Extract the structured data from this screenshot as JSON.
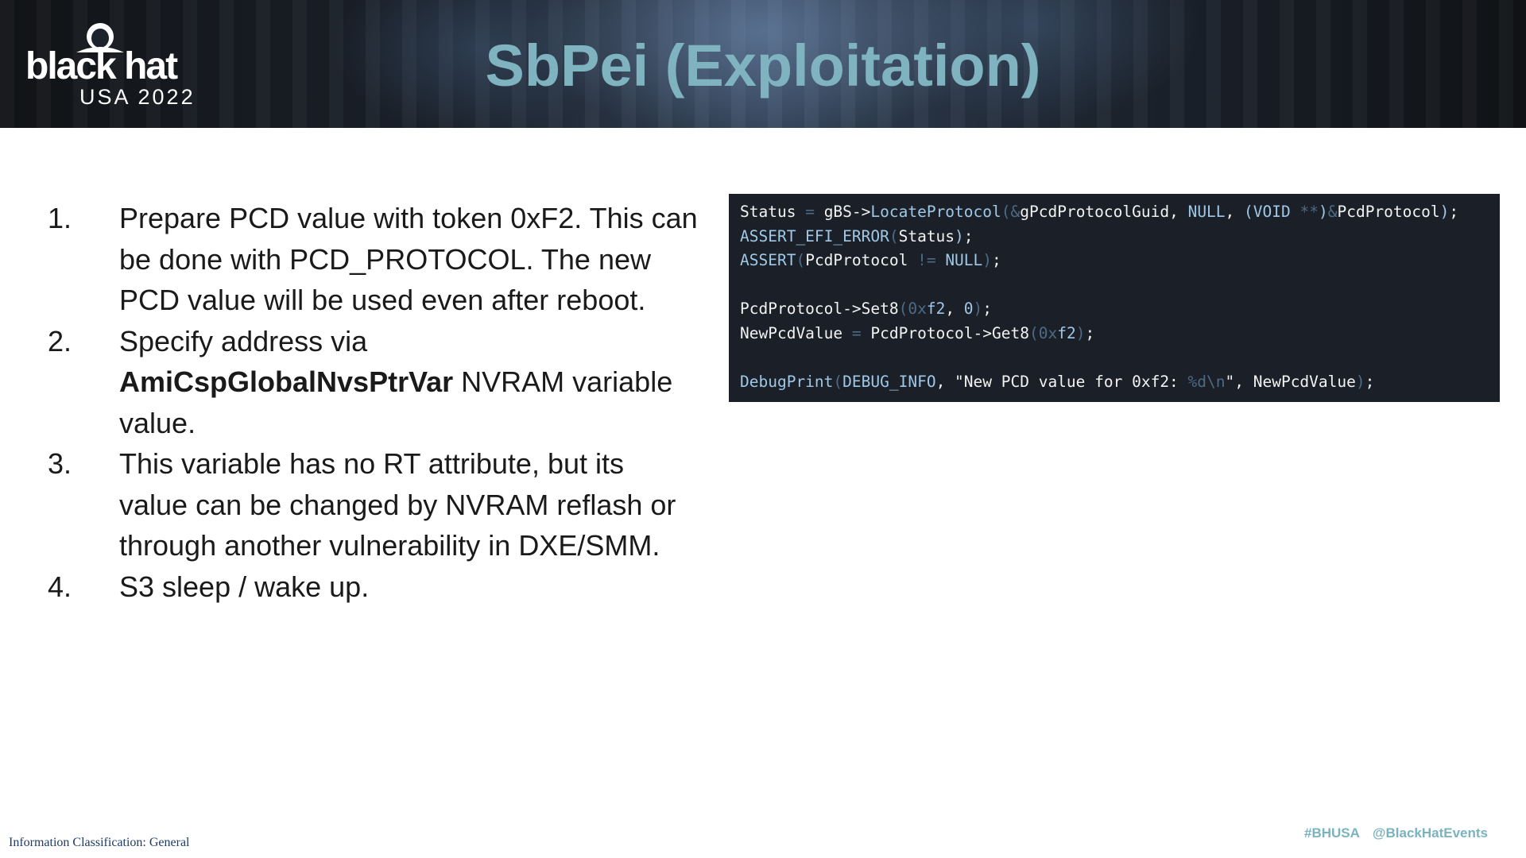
{
  "header": {
    "logo_word": "black hat",
    "logo_event": "USA 2022",
    "title": "SbPei (Exploitation)"
  },
  "steps": [
    {
      "num": "1.",
      "text": "Prepare PCD value with token 0xF2. This can be done with PCD_PROTOCOL. The new PCD value will be used even after reboot."
    },
    {
      "num": "2.",
      "text_before": "Specify address via",
      "text_bold": "AmiCspGlobalNvsPtrVar",
      "text_after": " NVRAM variable value."
    },
    {
      "num": "3.",
      "text": "This variable has no RT attribute, but its value can be changed by NVRAM reflash or through another vulnerability in DXE/SMM."
    },
    {
      "num": "4.",
      "text": "S3 sleep / wake up."
    }
  ],
  "code": {
    "lines": [
      [
        [
          "w",
          "Status"
        ],
        [
          "d",
          " = "
        ],
        [
          "w",
          "gBS->"
        ],
        [
          "b",
          "LocateProtocol"
        ],
        [
          "d",
          "(&"
        ],
        [
          "w",
          "gPcdProtocolGuid, "
        ],
        [
          "b",
          "NULL"
        ],
        [
          "w",
          ", "
        ],
        [
          "b",
          "(VOID"
        ],
        [
          "d",
          " **"
        ],
        [
          "b",
          ")"
        ],
        [
          "d",
          "&"
        ],
        [
          "w",
          "PcdProtocol"
        ],
        [
          "b",
          ")"
        ],
        [
          "w",
          ";"
        ]
      ],
      [
        [
          "b",
          "ASSERT_EFI_ERROR"
        ],
        [
          "d",
          "("
        ],
        [
          "w",
          "Status"
        ],
        [
          "b",
          ")"
        ],
        [
          "w",
          ";"
        ]
      ],
      [
        [
          "b",
          "ASSERT"
        ],
        [
          "d",
          "("
        ],
        [
          "w",
          "PcdProtocol"
        ],
        [
          "d",
          " != "
        ],
        [
          "b",
          "NULL"
        ],
        [
          "d",
          ")"
        ],
        [
          "w",
          ";"
        ]
      ],
      [],
      [
        [
          "w",
          "PcdProtocol->Set8"
        ],
        [
          "d",
          "(0x"
        ],
        [
          "b",
          "f2"
        ],
        [
          "w",
          ", "
        ],
        [
          "b",
          "0"
        ],
        [
          "d",
          ")"
        ],
        [
          "w",
          ";"
        ]
      ],
      [
        [
          "w",
          "NewPcdValue"
        ],
        [
          "d",
          " = "
        ],
        [
          "w",
          "PcdProtocol->Get8"
        ],
        [
          "d",
          "(0x"
        ],
        [
          "b",
          "f2"
        ],
        [
          "d",
          ")"
        ],
        [
          "w",
          ";"
        ]
      ],
      [],
      [
        [
          "b",
          "DebugPrint"
        ],
        [
          "d",
          "("
        ],
        [
          "b",
          "DEBUG_INFO"
        ],
        [
          "w",
          ", \"New PCD value for 0xf2: "
        ],
        [
          "d",
          "%d\\n"
        ],
        [
          "w",
          "\", NewPcdValue"
        ],
        [
          "d",
          ")"
        ],
        [
          "w",
          ";"
        ]
      ]
    ]
  },
  "footer": {
    "classification": "Information Classification: General",
    "hashtag": "#BHUSA",
    "handle": "@BlackHatEvents"
  },
  "colors": {
    "title": "#7fb3bf",
    "code_bg": "#1b2028",
    "code_keyword": "#9ec8e6",
    "tag": "#7ab3c0",
    "classification": "#1f3b66"
  }
}
